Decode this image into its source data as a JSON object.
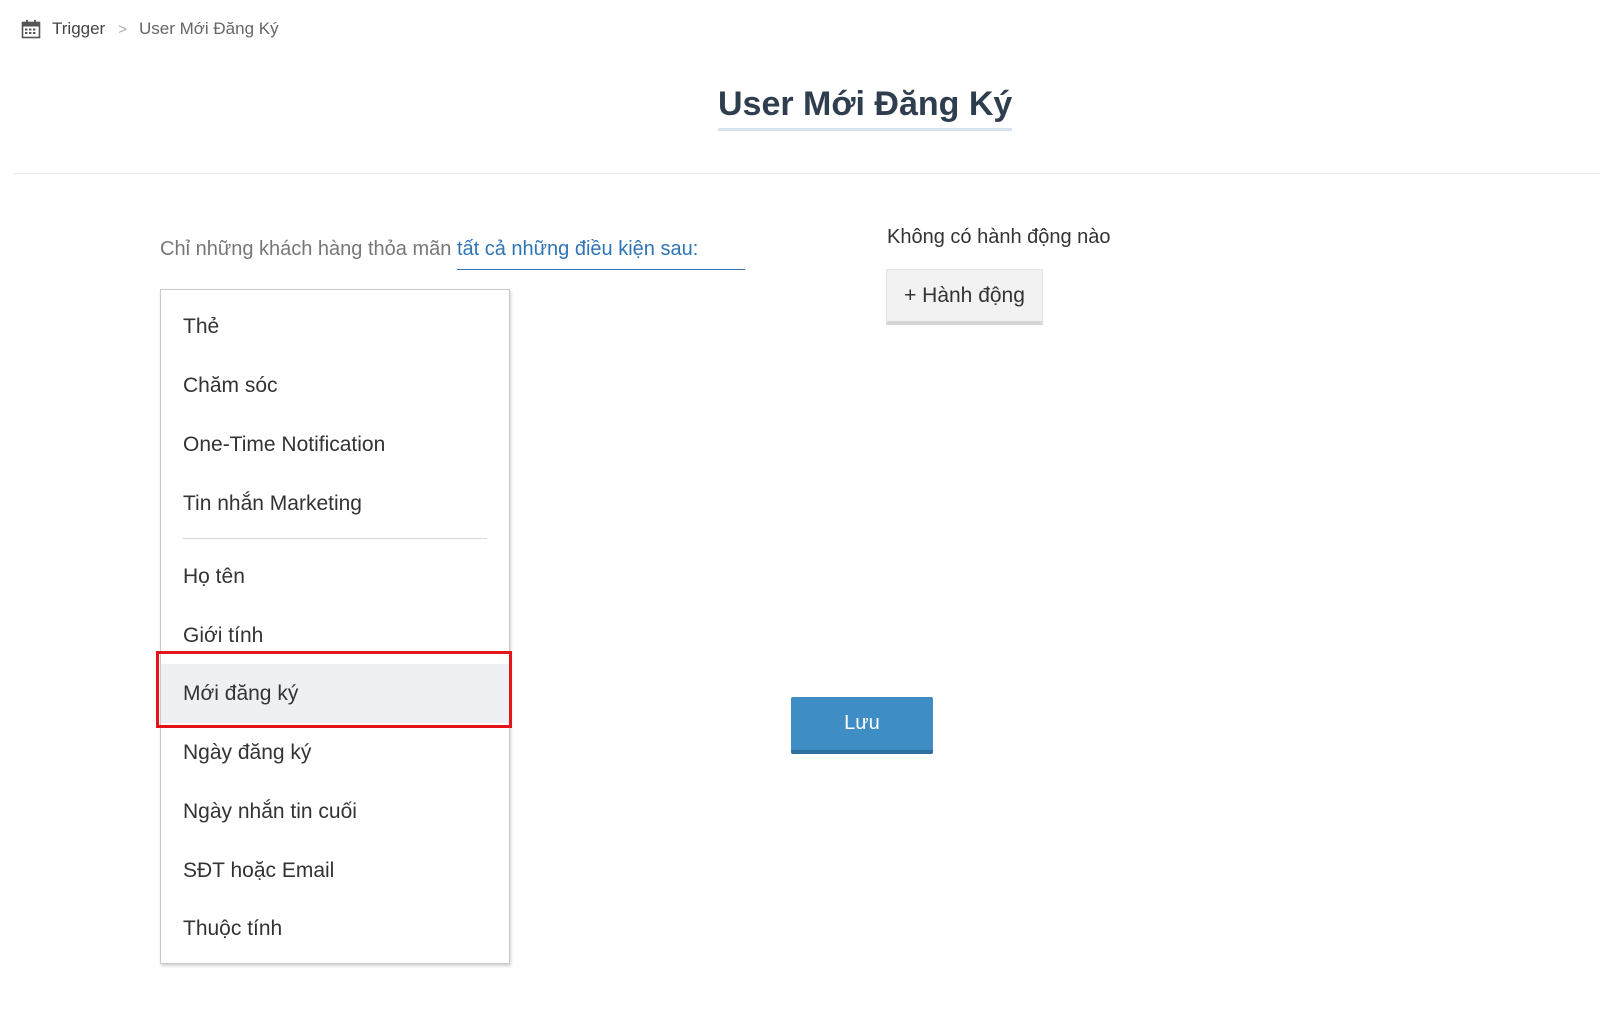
{
  "breadcrumb": {
    "icon": "calendar-icon",
    "root": "Trigger",
    "separator": ">",
    "current": "User Mới Đăng Ký"
  },
  "page": {
    "title": "User Mới Đăng Ký"
  },
  "condition": {
    "prefix": "Chỉ những khách hàng thỏa mãn",
    "link": "tất cả những điều kiện sau:"
  },
  "dropdown": {
    "group1": [
      "Thẻ",
      "Chăm sóc",
      "One-Time Notification",
      "Tin nhắn Marketing"
    ],
    "group2": [
      "Họ tên",
      "Giới tính",
      "Mới đăng ký",
      "Ngày đăng ký",
      "Ngày nhắn tin cuối",
      "SĐT hoặc Email",
      "Thuộc tính"
    ],
    "highlighted": "Mới đăng ký"
  },
  "actions": {
    "empty_text": "Không có hành động nào",
    "add_button": "+ Hành động"
  },
  "save_button": "Lưu",
  "colors": {
    "accent": "#3e8dc5",
    "link": "#2f74b5",
    "highlight_box": "#e5141b"
  }
}
